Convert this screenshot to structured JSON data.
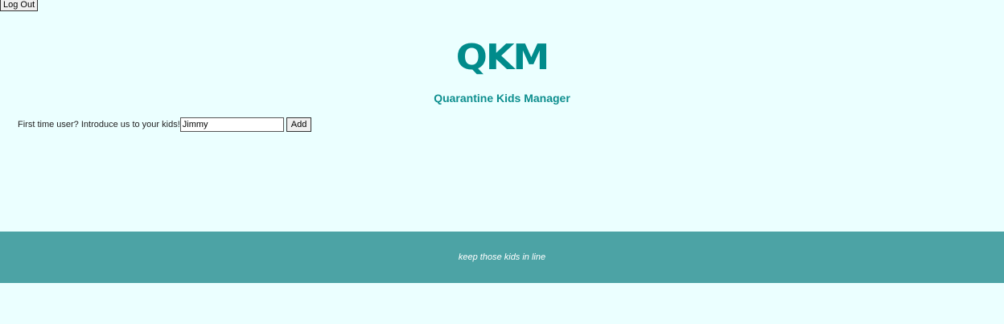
{
  "header": {
    "logout_label": "Log Out"
  },
  "branding": {
    "logo_text": "QKM",
    "app_title": "Quarantine Kids Manager",
    "accent_color": "#008b8b"
  },
  "intro": {
    "prompt": "First time user? Introduce us to your kids!",
    "kid_name_value": "Jimmy",
    "add_label": "Add"
  },
  "footer": {
    "tagline": "keep those kids in line",
    "background_color": "#4ca3a5"
  }
}
